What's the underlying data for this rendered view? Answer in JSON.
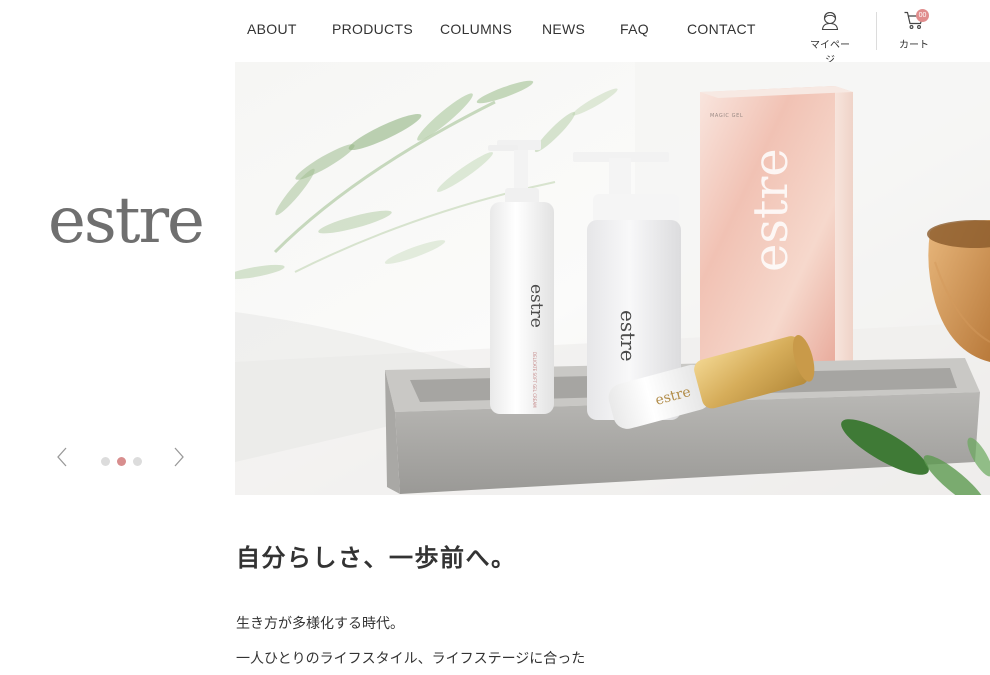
{
  "nav": {
    "items": [
      {
        "label": "ABOUT"
      },
      {
        "label": "PRODUCTS"
      },
      {
        "label": "COLUMNS"
      },
      {
        "label": "NEWS"
      },
      {
        "label": "FAQ"
      },
      {
        "label": "CONTACT"
      }
    ],
    "account_label": "マイページ",
    "cart_label": "カート",
    "cart_count": "00"
  },
  "brand": {
    "logo_text": "estre"
  },
  "slider": {
    "slide_count": 3,
    "active_index": 1
  },
  "hero": {
    "bottle_brand": "estre",
    "box_brand": "estre",
    "box_small_text": "MAGIC GEL",
    "bottle_small_text": "DELICATE SOFT GEL CREAM",
    "serum_brand": "estre"
  },
  "content": {
    "headline": "自分らしさ、一歩前へ。",
    "paragraph_1": "生き方が多様化する時代。",
    "paragraph_2": "一人ひとりのライフスタイル、ライフステージに合った"
  },
  "colors": {
    "accent": "#d88e8e",
    "logo": "#6f6f6f",
    "text": "#333333"
  }
}
